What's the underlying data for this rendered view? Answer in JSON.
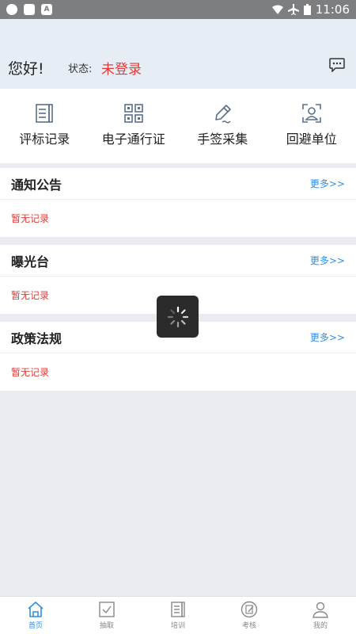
{
  "status_bar": {
    "time": "11:06"
  },
  "header": {
    "greeting": "您好!",
    "state_label": "状态:",
    "state_value": "未登录"
  },
  "quick_actions": [
    {
      "label": "评标记录",
      "icon": "record-list-icon"
    },
    {
      "label": "电子通行证",
      "icon": "qr-code-icon"
    },
    {
      "label": "手签采集",
      "icon": "pen-signature-icon"
    },
    {
      "label": "回避单位",
      "icon": "person-frame-icon"
    }
  ],
  "sections": [
    {
      "title": "通知公告",
      "more": "更多>>",
      "empty": "暂无记录"
    },
    {
      "title": "曝光台",
      "more": "更多>>",
      "empty": "暂无记录"
    },
    {
      "title": "政策法规",
      "more": "更多>>",
      "empty": "暂无记录"
    }
  ],
  "tabs": [
    {
      "label": "首页",
      "icon": "home-icon",
      "active": true
    },
    {
      "label": "抽取",
      "icon": "checkbox-icon",
      "active": false
    },
    {
      "label": "培训",
      "icon": "book-icon",
      "active": false
    },
    {
      "label": "考核",
      "icon": "exam-icon",
      "active": false
    },
    {
      "label": "我的",
      "icon": "user-icon",
      "active": false
    }
  ],
  "colors": {
    "accent": "#2c8ee8",
    "alert": "#e53935",
    "header_bg": "#e6edf5",
    "status_bar": "#7d7e80"
  }
}
